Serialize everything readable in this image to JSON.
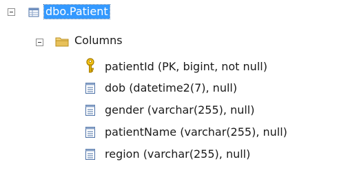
{
  "tree": {
    "table": {
      "label": "dbo.Patient",
      "icon": "table-icon",
      "expanded": true,
      "selected": true
    },
    "folder": {
      "label": "Columns",
      "icon": "folder-icon",
      "expanded": true
    },
    "columns": [
      {
        "label": "patientId (PK, bigint, not null)",
        "icon": "primary-key-icon"
      },
      {
        "label": "dob (datetime2(7), null)",
        "icon": "column-icon"
      },
      {
        "label": "gender (varchar(255), null)",
        "icon": "column-icon"
      },
      {
        "label": "patientName (varchar(255), null)",
        "icon": "column-icon"
      },
      {
        "label": "region (varchar(255), null)",
        "icon": "column-icon"
      }
    ]
  },
  "colors": {
    "selection": "#3399ff",
    "folder": "#e8c15a",
    "key": "#d9a400",
    "column_icon": "#4a6fa5"
  }
}
